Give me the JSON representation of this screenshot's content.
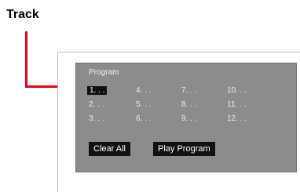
{
  "callout": {
    "label": "Track"
  },
  "program_panel": {
    "title": "Program",
    "tracks": [
      {
        "label": "1. . ."
      },
      {
        "label": "2. . ."
      },
      {
        "label": "3. . ."
      },
      {
        "label": "4. . ."
      },
      {
        "label": "5. . ."
      },
      {
        "label": "6. . ."
      },
      {
        "label": "7. . ."
      },
      {
        "label": "8. . ."
      },
      {
        "label": "9. . ."
      },
      {
        "label": "10. . ."
      },
      {
        "label": "11. . ."
      },
      {
        "label": "12. . ."
      }
    ],
    "selected_track": "1",
    "buttons": {
      "clear_all": "Clear All",
      "play_program": "Play Program"
    }
  }
}
